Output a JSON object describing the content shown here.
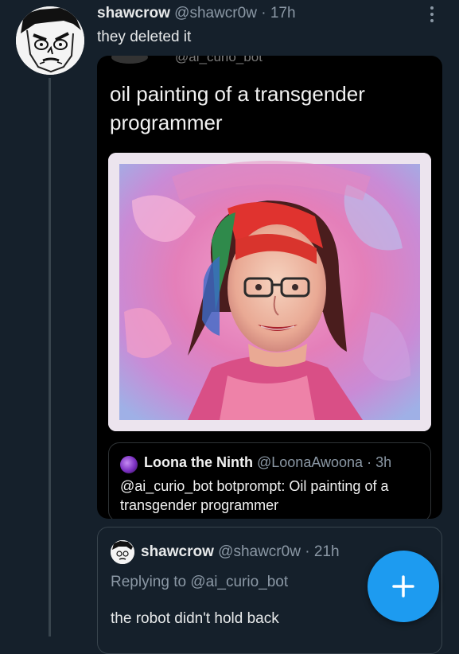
{
  "tweet": {
    "author_name": "shawcrow",
    "author_handle": "@shawcr0w",
    "separator": "·",
    "time": "17h",
    "text": "they deleted it",
    "more_icon": "more-vertical-icon"
  },
  "embedded_screenshot": {
    "cutoff_handle": "@ai_curio_bot",
    "title": "oil painting of a transgender programmer",
    "image": "oil-painting-portrait",
    "quoted_tweet": {
      "author_name": "Loona the Ninth",
      "author_handle": "@LoonaAwoona",
      "separator": "·",
      "time": "3h",
      "text": "@ai_curio_bot botprompt: Oil painting of a transgender programmer"
    }
  },
  "reply": {
    "author_name": "shawcrow",
    "author_handle": "@shawcr0w",
    "separator": "·",
    "time": "21h",
    "replying_to": "Replying to @ai_curio_bot",
    "text": "the robot didn't hold back"
  },
  "fab": {
    "icon": "plus-icon",
    "color": "#1d9bf0"
  },
  "colors": {
    "background": "#15202b",
    "muted_text": "#8b98a5",
    "accent": "#1d9bf0"
  }
}
